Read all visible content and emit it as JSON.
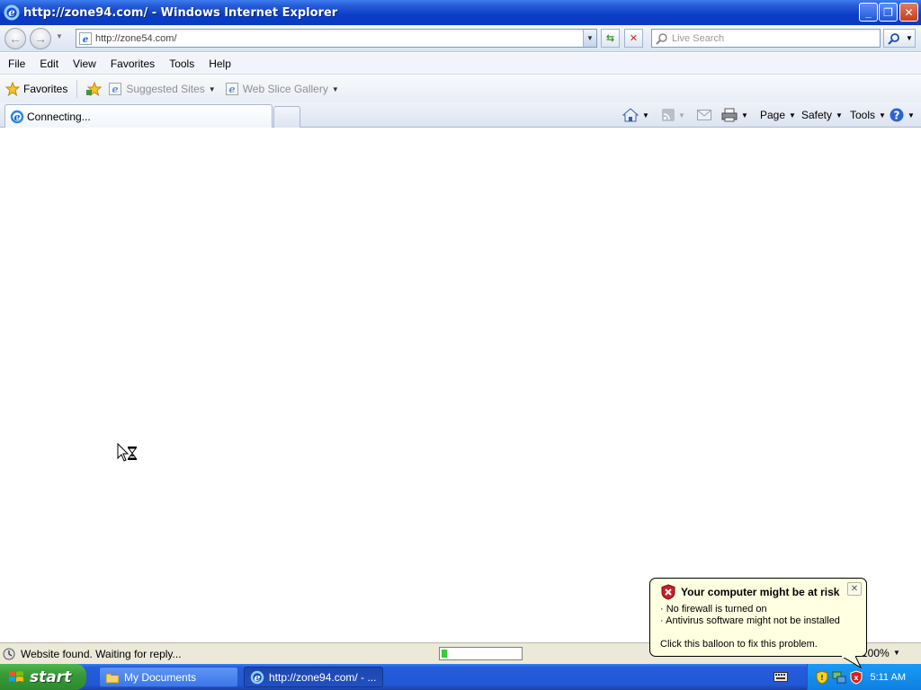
{
  "window": {
    "title": "http://zone94.com/ - Windows Internet Explorer",
    "minimize": "_",
    "restore": "❐",
    "close": "✕"
  },
  "address": {
    "url": "http://zone54.com/",
    "search_placeholder": "Live Search"
  },
  "menu": {
    "items": [
      "File",
      "Edit",
      "View",
      "Favorites",
      "Tools",
      "Help"
    ]
  },
  "favorites_bar": {
    "favorites": "Favorites",
    "suggested_sites": "Suggested Sites",
    "web_slice_gallery": "Web Slice Gallery"
  },
  "tabs": {
    "active_label": "Connecting..."
  },
  "command_bar": {
    "page": "Page",
    "safety": "Safety",
    "tools": "Tools"
  },
  "status": {
    "text": "Website found. Waiting for reply...",
    "zoom": "100%",
    "progress": 0.07
  },
  "balloon": {
    "title": "Your computer might be at risk",
    "line1": "· No firewall is turned on",
    "line2": "· Antivirus software might not be installed",
    "footer": "Click this balloon to fix this problem."
  },
  "taskbar": {
    "start": "start",
    "items": [
      "My Documents",
      "http://zone94.com/ - ..."
    ],
    "clock": "5:11 AM"
  },
  "icons": [
    "ie-icon",
    "back-icon",
    "forward-icon",
    "refresh-icon",
    "stop-icon",
    "search-icon",
    "star-icon",
    "home-icon",
    "feeds-icon",
    "mail-icon",
    "print-icon",
    "help-icon",
    "hourglass-cursor-icon",
    "shield-warning-icon",
    "folder-icon",
    "keyboard-icon"
  ]
}
